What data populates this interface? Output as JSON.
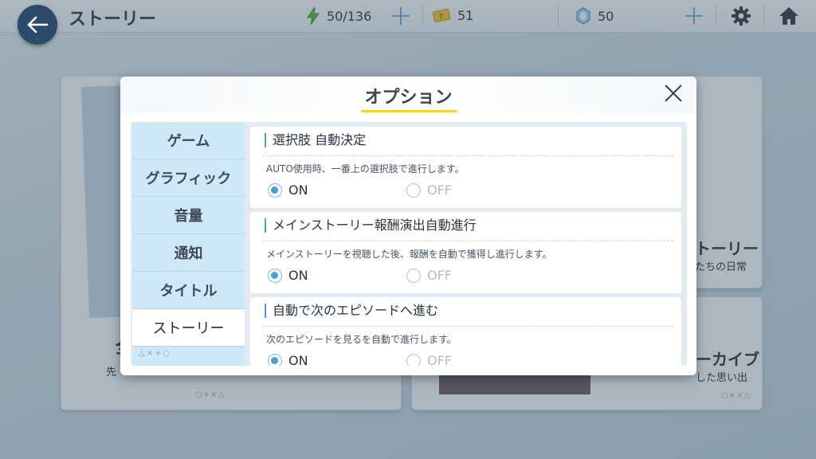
{
  "header": {
    "title": "ストーリー",
    "stamina": "50/136",
    "tickets": "51",
    "crystals": "50"
  },
  "background_cards": {
    "left_desc_partial": "先",
    "left_title_partial": "全",
    "right_top_title_partial": "トーリー",
    "right_top_desc_partial": "たちの日常",
    "right_bottom_title_partial": "ーカイブ",
    "right_bottom_desc_partial": "した思い出",
    "deco_symbols": "○+×△"
  },
  "dialog": {
    "title": "オプション",
    "tabs": [
      {
        "label": "ゲーム"
      },
      {
        "label": "グラフィック"
      },
      {
        "label": "音量"
      },
      {
        "label": "通知"
      },
      {
        "label": "タイトル"
      },
      {
        "label": "ストーリー"
      }
    ],
    "active_tab": "ストーリー",
    "tabs_deco": "△×+○",
    "settings": [
      {
        "title": "選択肢 自動決定",
        "description": "AUTO使用時、一番上の選択肢で進行します。",
        "on_label": "ON",
        "off_label": "OFF",
        "selected": "ON"
      },
      {
        "title": "メインストーリー報酬演出自動進行",
        "description": "メインストーリーを視聴した後、報酬を自動で獲得し進行します。",
        "on_label": "ON",
        "off_label": "OFF",
        "selected": "ON"
      },
      {
        "title": "自動で次のエピソードへ進む",
        "description": "次のエピソードを見るを自動で進行します。",
        "on_label": "ON",
        "off_label": "OFF",
        "selected": "ON"
      }
    ]
  },
  "colors": {
    "accent": "#4c9fd6",
    "title_underline": "#f1d33a",
    "tab_bg": "#cfe8f7",
    "back_button": "#2c4a6b"
  }
}
